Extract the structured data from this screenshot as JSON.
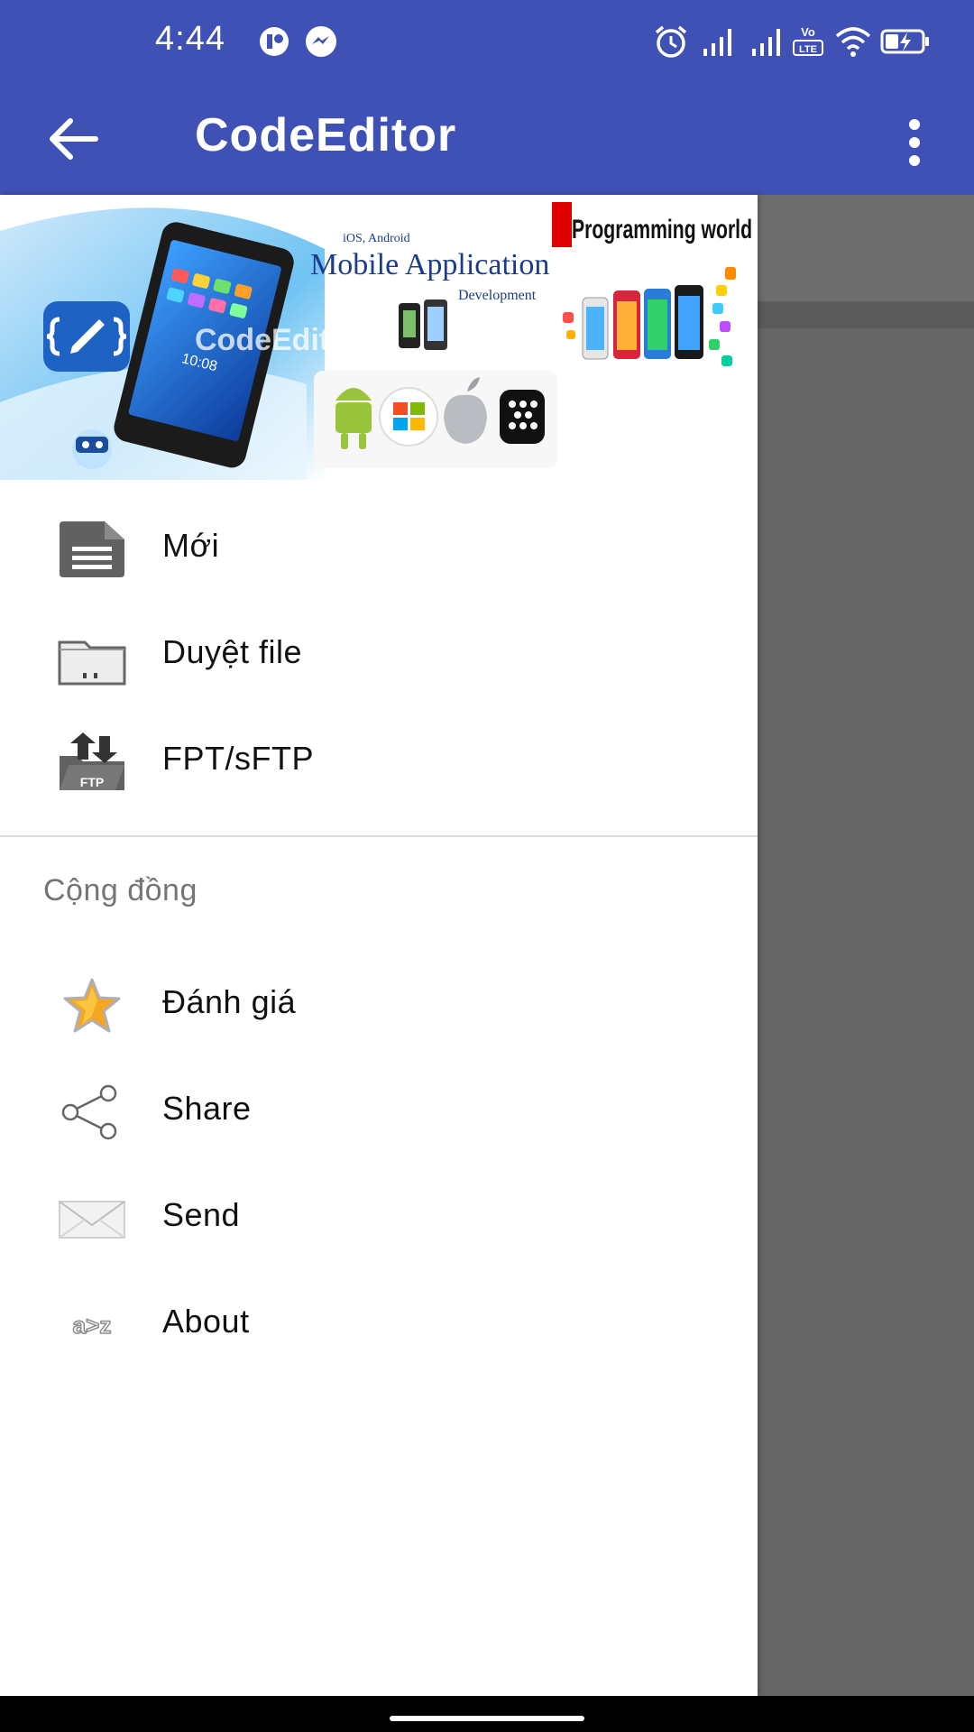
{
  "status_bar": {
    "time": "4:44",
    "icons": [
      "notification-app-icon",
      "messenger-icon",
      "alarm-icon",
      "signal-icon",
      "signal-icon",
      "volte-icon",
      "wifi-icon",
      "battery-charging-icon"
    ],
    "volte_label": "Vo LTE"
  },
  "app_bar": {
    "title": "CodeEditor",
    "back_icon": "arrow-back-icon",
    "overflow_icon": "more-vert-icon",
    "color": "#3f51b5"
  },
  "drawer": {
    "banner": {
      "platform_caption": "iOS, Android",
      "headline": "Mobile Application",
      "subline": "Development",
      "brand_tag": "Programming world",
      "logo_text": "CodeEdit",
      "device_clock": "10:08"
    },
    "main_items": [
      {
        "label": "Mới",
        "icon": "new-file-icon"
      },
      {
        "label": "Duyệt file",
        "icon": "folder-icon"
      },
      {
        "label": "FPT/sFTP",
        "icon": "ftp-folder-icon",
        "icon_text": "FTP"
      }
    ],
    "section_header": "Cộng đồng",
    "community_items": [
      {
        "label": "Đánh giá",
        "icon": "star-icon"
      },
      {
        "label": "Share",
        "icon": "share-icon"
      },
      {
        "label": "Send",
        "icon": "envelope-icon"
      },
      {
        "label": "About",
        "icon": "about-icon",
        "icon_text": "a>z"
      }
    ]
  }
}
